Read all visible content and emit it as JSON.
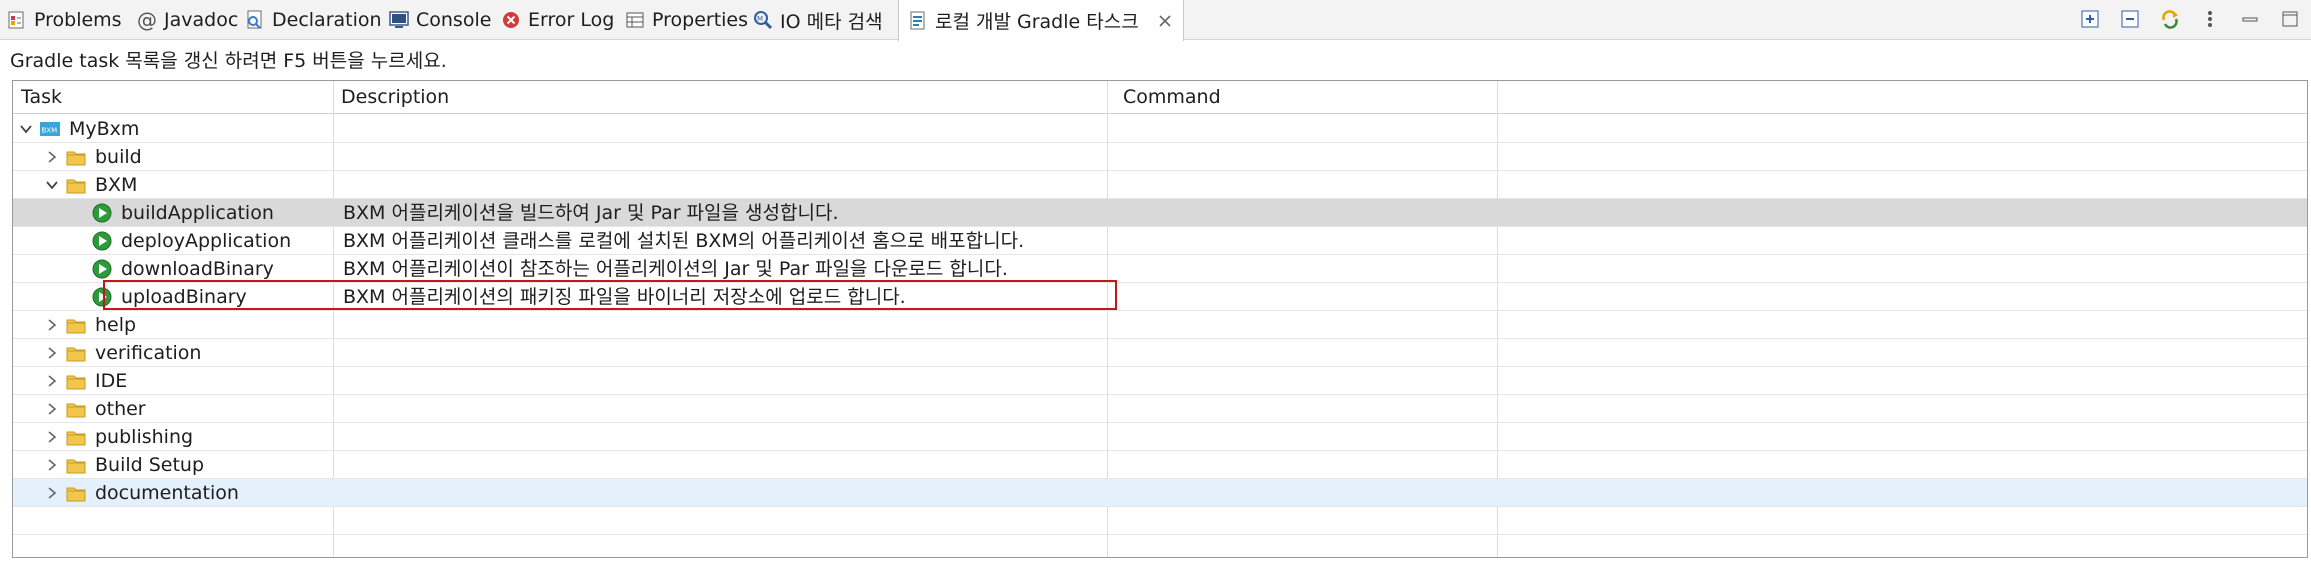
{
  "tabs": [
    {
      "label": "Problems",
      "icon": "problems-icon"
    },
    {
      "label": "Javadoc",
      "icon": "javadoc-at-icon"
    },
    {
      "label": "Declaration",
      "icon": "declaration-icon"
    },
    {
      "label": "Console",
      "icon": "console-icon"
    },
    {
      "label": "Error Log",
      "icon": "error-log-icon"
    },
    {
      "label": "Properties",
      "icon": "properties-icon"
    },
    {
      "label": "IO 메타 검색",
      "icon": "io-meta-search-icon"
    },
    {
      "label": "로컬 개발 Gradle 타스크",
      "icon": "gradle-tasks-icon",
      "active": true
    }
  ],
  "hint": "Gradle task 목록을 갱신 하려면 F5 버튼을 누르세요.",
  "columns": {
    "task": "Task",
    "description": "Description",
    "command": "Command"
  },
  "tree": {
    "root": "MyBxm",
    "root_badge": "BXM",
    "nodes": [
      {
        "label": "build",
        "type": "folder",
        "expanded": false,
        "desc": ""
      },
      {
        "label": "BXM",
        "type": "folder",
        "expanded": true,
        "desc": ""
      },
      {
        "label": "buildApplication",
        "type": "task",
        "desc": "BXM 어플리케이션을 빌드하여 Jar 및 Par 파일을 생성합니다."
      },
      {
        "label": "deployApplication",
        "type": "task",
        "desc": "BXM 어플리케이션 클래스를 로컬에 설치된 BXM의 어플리케이션 홈으로 배포합니다."
      },
      {
        "label": "downloadBinary",
        "type": "task",
        "desc": "BXM 어플리케이션이 참조하는 어플리케이션의 Jar 및 Par 파일을 다운로드 합니다."
      },
      {
        "label": "uploadBinary",
        "type": "task",
        "desc": "BXM 어플리케이션의 패키징 파일을 바이너리 저장소에 업로드 합니다."
      },
      {
        "label": "help",
        "type": "folder",
        "expanded": false,
        "desc": ""
      },
      {
        "label": "verification",
        "type": "folder",
        "expanded": false,
        "desc": ""
      },
      {
        "label": "IDE",
        "type": "folder",
        "expanded": false,
        "desc": ""
      },
      {
        "label": "other",
        "type": "folder",
        "expanded": false,
        "desc": ""
      },
      {
        "label": "publishing",
        "type": "folder",
        "expanded": false,
        "desc": ""
      },
      {
        "label": "Build Setup",
        "type": "folder",
        "expanded": false,
        "desc": ""
      },
      {
        "label": "documentation",
        "type": "folder",
        "expanded": false,
        "desc": ""
      }
    ]
  },
  "colors": {
    "selected_row": "#d9d9d9",
    "hover_row": "#e4f0fb",
    "highlight_border": "#c4161c",
    "run_icon": "#2e9a3a",
    "folder": "#f2c64b"
  }
}
